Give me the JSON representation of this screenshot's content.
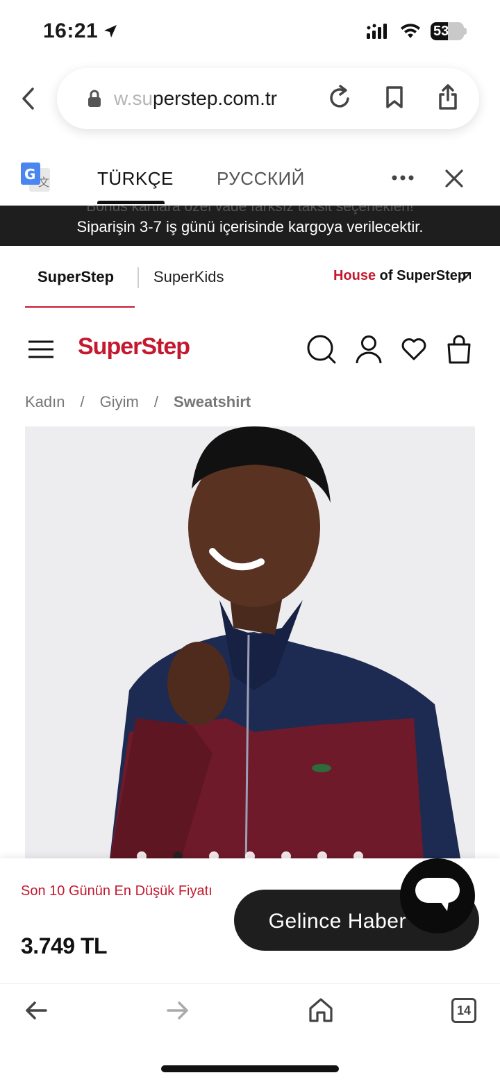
{
  "status_bar": {
    "time": "16:21",
    "battery": "53"
  },
  "browser": {
    "url_faded": "w.su",
    "url_main": "perstep.com.tr"
  },
  "translate": {
    "tab_active": "TÜRKÇE",
    "tab_other": "РУССКИЙ"
  },
  "announcement": {
    "ghost": "Bonus kartlara özel vade farksız taksit seçenekleri!",
    "text": "Siparişin 3-7 iş günü içerisinde kargoya verilecektir."
  },
  "brand_nav": {
    "tab_1": "SuperStep",
    "tab_2": "SuperKids",
    "house_prefix": "House",
    "house_suffix": " of SuperStep"
  },
  "header": {
    "logo": "SuperStep"
  },
  "breadcrumb": {
    "items": [
      "Kadın",
      "/",
      "Giyim",
      "/",
      "Sweatshirt"
    ]
  },
  "product": {
    "image_index_active": 1,
    "image_count": 7
  },
  "buy_bar": {
    "low_price_label": "Son 10 Günün En Düşük Fiyatı",
    "price": "3.749 TL",
    "notify_button": "Gelince Haber Ver"
  },
  "bottom_bar": {
    "tab_count": "14"
  },
  "colors": {
    "brand_red": "#c4182f",
    "dark": "#1e1e1e"
  }
}
